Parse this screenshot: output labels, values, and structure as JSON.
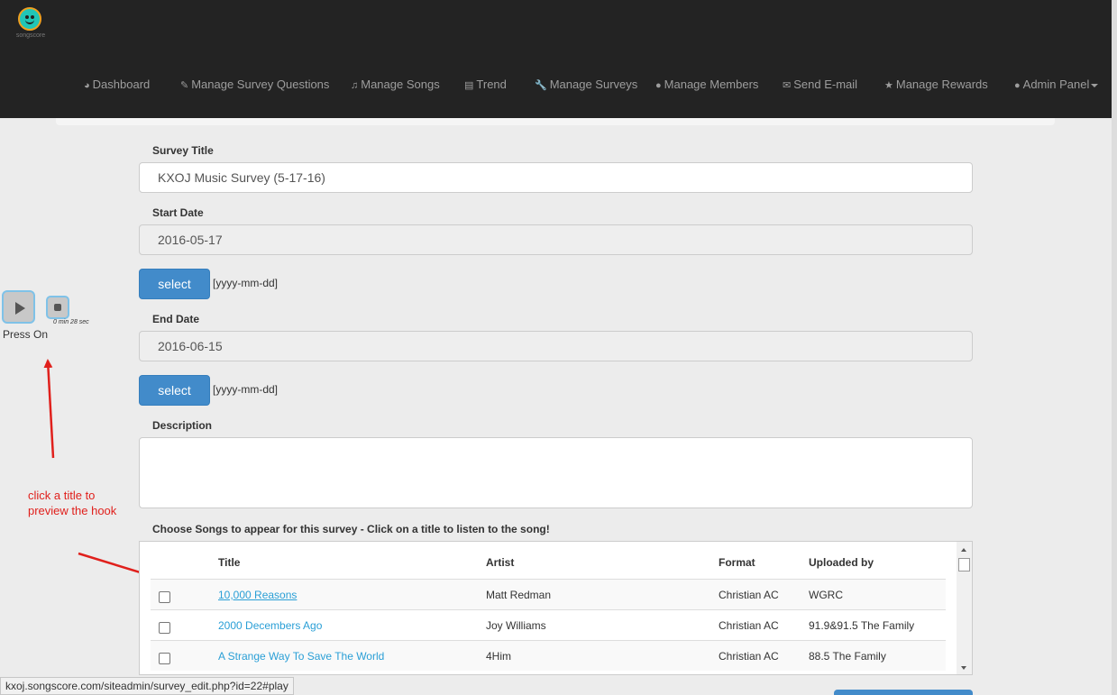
{
  "brand": {
    "logo_text": "songscore"
  },
  "nav": [
    {
      "label": "Dashboard",
      "icon": "dashboard-icon"
    },
    {
      "label": "Manage Survey Questions",
      "icon": "edit-icon"
    },
    {
      "label": "Manage Songs",
      "icon": "music-icon"
    },
    {
      "label": "Trend",
      "icon": "bar-chart-icon"
    },
    {
      "label": "Manage Surveys",
      "icon": "wrench-icon"
    },
    {
      "label": "Manage Members",
      "icon": "user-icon"
    },
    {
      "label": "Send E-mail",
      "icon": "envelope-icon"
    },
    {
      "label": "Manage Rewards",
      "icon": "star-icon"
    },
    {
      "label": "Admin Panel",
      "icon": "user-icon"
    }
  ],
  "form": {
    "survey_title_label": "Survey Title",
    "survey_title_value": "KXOJ Music Survey (5-17-16)",
    "start_date_label": "Start Date",
    "start_date_value": "2016-05-17",
    "end_date_label": "End Date",
    "end_date_value": "2016-06-15",
    "select_label": "select",
    "date_format_hint": "[yyyy-mm-dd]",
    "description_label": "Description",
    "description_value": "",
    "songs_label": "Choose Songs to appear for this survey - Click on a title to listen to the song!"
  },
  "player": {
    "timer": "0 min 28 sec",
    "now_playing": "Press On"
  },
  "annotation": {
    "line1": "click a title to",
    "line2": "preview the hook"
  },
  "songs_table": {
    "columns": [
      "Title",
      "Artist",
      "Format",
      "Uploaded by"
    ],
    "rows": [
      {
        "title": "10,000 Reasons",
        "artist": "Matt Redman",
        "format": "Christian AC",
        "uploaded_by": "WGRC"
      },
      {
        "title": "2000 Decembers Ago",
        "artist": "Joy Williams",
        "format": "Christian AC",
        "uploaded_by": "91.9&91.5 The Family"
      },
      {
        "title": "A Strange Way To Save The World",
        "artist": "4Him",
        "format": "Christian AC",
        "uploaded_by": "88.5 The Family"
      }
    ]
  },
  "status_bar": {
    "url": "kxoj.songscore.com/siteadmin/survey_edit.php?id=22#play"
  },
  "colors": {
    "topbar": "#232323",
    "primary_button": "#428bca",
    "link": "#2a9fd6",
    "annotation": "#e0201c"
  }
}
